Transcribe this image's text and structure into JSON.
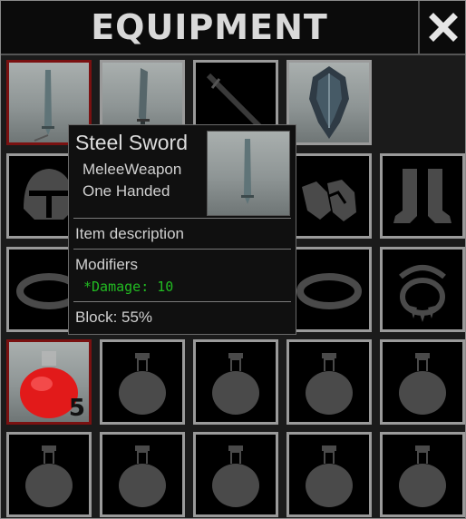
{
  "window": {
    "title": "EQUIPMENT",
    "close_icon": "close-icon"
  },
  "grid": {
    "rows": [
      [
        "sword-steel",
        "sword-broad",
        "sword-dark",
        "shield-ornate",
        "empty"
      ],
      [
        "helmet-icon",
        "chest-icon",
        "gloves-icon",
        "gloves-icon",
        "boots-icon"
      ],
      [
        "ring-icon",
        "ring-icon",
        "ring-icon",
        "ring-icon",
        "amulet-icon"
      ],
      [
        "health-potion",
        "potion-icon",
        "potion-icon",
        "potion-icon",
        "potion-icon"
      ],
      [
        "potion-icon",
        "potion-icon",
        "potion-icon",
        "potion-icon",
        "potion-icon"
      ]
    ],
    "potion_count": "5"
  },
  "tooltip": {
    "name": "Steel Sword",
    "type": "MeleeWeapon",
    "handedness": "One Handed",
    "description": "Item description",
    "modifiers_heading": "Modifiers",
    "modifier": "*Damage: 10",
    "block": "Block: 55%"
  },
  "colors": {
    "slot_border": "#9a9a9a",
    "selected_border": "#7a1111",
    "modifier_text": "#22bb22",
    "icon": "#4a4a4a"
  }
}
